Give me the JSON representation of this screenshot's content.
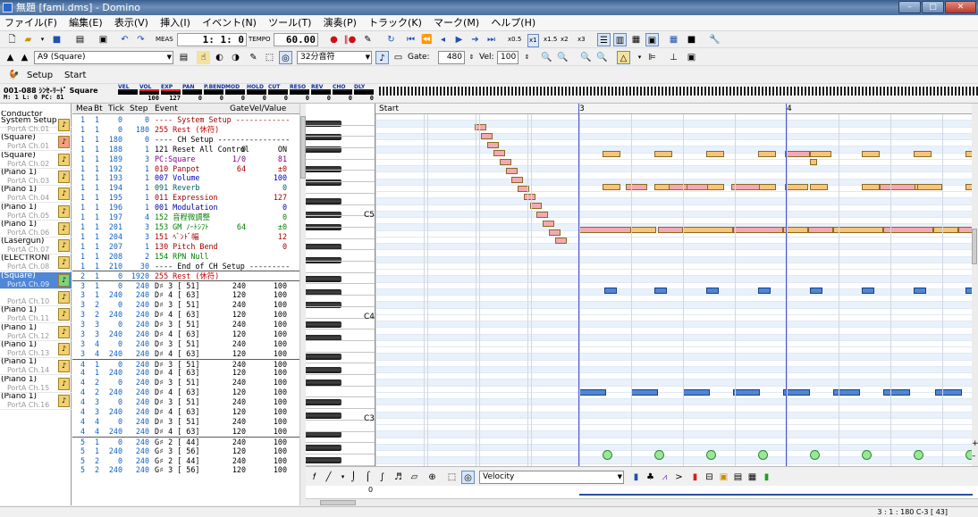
{
  "window": {
    "title": "無題 [fami.dms] - Domino",
    "min": "–",
    "max": "□",
    "close": "✕"
  },
  "menu": [
    "ファイル(F)",
    "編集(E)",
    "表示(V)",
    "挿入(I)",
    "イベント(N)",
    "ツール(T)",
    "演奏(P)",
    "トラック(K)",
    "マーク(M)",
    "ヘルプ(H)"
  ],
  "toolbar1": {
    "meas_label": "MEAS",
    "position": "1:  1:    0",
    "tempo_label": "TEMPO",
    "tempo": "60.00",
    "speeds": [
      "x0.5",
      "x1",
      "x1.5",
      "x2",
      "x3"
    ]
  },
  "toolbar2": {
    "track_combo": "A9 (Square)",
    "note_length": "32分音符",
    "gate_label": "Gate:",
    "gate": "480",
    "vel_label": "Vel:",
    "vel": "100"
  },
  "toolbar3": {
    "setup": "Setup",
    "start": "Start"
  },
  "channel": {
    "range": "001-088 ｼﾝｾ-ﾘｰﾄﾞ Square",
    "m": "M:",
    "m_val": "1",
    "l": "L:",
    "l_val": "0",
    "pc": "PC:",
    "pc_val": "81",
    "labels": [
      "VEL",
      "VOL",
      "EXP",
      "PAN",
      "P.BEND",
      "MOD",
      "HOLD",
      "CUT",
      "RESO",
      "REV",
      "CHO",
      "DLY"
    ],
    "values": [
      "",
      "100",
      "127",
      "0",
      "0",
      "0",
      "0",
      "0",
      "0",
      "0",
      "0",
      "0"
    ]
  },
  "tracks": [
    {
      "name": "Conductor",
      "port": ""
    },
    {
      "name": "System Setup",
      "port": "PortA  Ch.01"
    },
    {
      "name": "(Square)",
      "port": "PortA  Ch.01"
    },
    {
      "name": "(Square)",
      "port": "PortA  Ch.02"
    },
    {
      "name": "(Piano 1)",
      "port": "PortA  Ch.03"
    },
    {
      "name": "(Piano 1)",
      "port": "PortA  Ch.04"
    },
    {
      "name": "(Piano 1)",
      "port": "PortA  Ch.05"
    },
    {
      "name": "(Piano 1)",
      "port": "PortA  Ch.06"
    },
    {
      "name": "(Lasergun)",
      "port": "PortA  Ch.07"
    },
    {
      "name": "(ELECTRONI",
      "port": "PortA  Ch.08"
    },
    {
      "name": "(Square)",
      "port": "PortA  Ch.09",
      "selected": true
    },
    {
      "name": "",
      "port": "PortA  Ch.10"
    },
    {
      "name": "(Piano 1)",
      "port": "PortA  Ch.11"
    },
    {
      "name": "(Piano 1)",
      "port": "PortA  Ch.12"
    },
    {
      "name": "(Piano 1)",
      "port": "PortA  Ch.13"
    },
    {
      "name": "(Piano 1)",
      "port": "PortA  Ch.14"
    },
    {
      "name": "(Piano 1)",
      "port": "PortA  Ch.15"
    },
    {
      "name": "(Piano 1)",
      "port": "PortA  Ch.16"
    }
  ],
  "event_headers": [
    "Mea",
    "Bt",
    "Tick",
    "Step",
    "Event",
    "Gate",
    "Vel/Value"
  ],
  "events": [
    [
      "1",
      "1",
      "0",
      "0",
      "---- System Setup ------------",
      "",
      "",
      "#a00000"
    ],
    [
      "1",
      "1",
      "0",
      "180",
      "255 Rest (休符)",
      "",
      "",
      "#c00000"
    ],
    [
      "1",
      "1",
      "180",
      "0",
      "---- CH Setup ----------------",
      "",
      "",
      "#000000"
    ],
    [
      "1",
      "1",
      "188",
      "1",
      "121 Reset All Control",
      "0",
      "ON",
      "#000000"
    ],
    [
      "1",
      "1",
      "189",
      "3",
      "PC:Square",
      "1/0",
      "81",
      "#7a008a"
    ],
    [
      "1",
      "1",
      "192",
      "1",
      "010 Panpot",
      "64",
      "±0",
      "#a00000"
    ],
    [
      "1",
      "1",
      "193",
      "1",
      "007 Volume",
      "",
      "100",
      "#0000c0"
    ],
    [
      "1",
      "1",
      "194",
      "1",
      "091 Reverb",
      "",
      "0",
      "#006060"
    ],
    [
      "1",
      "1",
      "195",
      "1",
      "011 Expression",
      "",
      "127",
      "#a00000"
    ],
    [
      "1",
      "1",
      "196",
      "1",
      "001 Modulation",
      "",
      "0",
      "#0000a0"
    ],
    [
      "1",
      "1",
      "197",
      "4",
      "152 音程微調整",
      "",
      "0",
      "#008000"
    ],
    [
      "1",
      "1",
      "201",
      "3",
      "153 GM ﾉｰﾄｼﾌﾄ",
      "64",
      "±0",
      "#008000"
    ],
    [
      "1",
      "1",
      "204",
      "3",
      "151 ﾍﾞﾝﾄﾞ幅",
      "",
      "12",
      "#a00000"
    ],
    [
      "1",
      "1",
      "207",
      "1",
      "130 Pitch Bend",
      "",
      "0",
      "#a00000"
    ],
    [
      "1",
      "1",
      "208",
      "2",
      "154 RPN Null",
      "",
      "",
      "#008000"
    ],
    [
      "1",
      "1",
      "210",
      "30",
      "---- End of CH Setup ---------",
      "",
      "",
      "#000000"
    ],
    [
      "2",
      "1",
      "0",
      "1920",
      "255 Rest (休符)",
      "",
      "",
      "#c00000"
    ],
    [
      "3",
      "1",
      "0",
      "240",
      "D♯ 3 [ 51]",
      "240",
      "100",
      "#000000"
    ],
    [
      "3",
      "1",
      "240",
      "240",
      "D♯ 4 [ 63]",
      "120",
      "100",
      "#000000"
    ],
    [
      "3",
      "2",
      "0",
      "240",
      "D♯ 3 [ 51]",
      "240",
      "100",
      "#000000"
    ],
    [
      "3",
      "2",
      "240",
      "240",
      "D♯ 4 [ 63]",
      "120",
      "100",
      "#000000"
    ],
    [
      "3",
      "3",
      "0",
      "240",
      "D♯ 3 [ 51]",
      "240",
      "100",
      "#000000"
    ],
    [
      "3",
      "3",
      "240",
      "240",
      "D♯ 4 [ 63]",
      "120",
      "100",
      "#000000"
    ],
    [
      "3",
      "4",
      "0",
      "240",
      "D♯ 3 [ 51]",
      "240",
      "100",
      "#000000"
    ],
    [
      "3",
      "4",
      "240",
      "240",
      "D♯ 4 [ 63]",
      "120",
      "100",
      "#000000"
    ],
    [
      "4",
      "1",
      "0",
      "240",
      "D♯ 3 [ 51]",
      "240",
      "100",
      "#000000"
    ],
    [
      "4",
      "1",
      "240",
      "240",
      "D♯ 4 [ 63]",
      "120",
      "100",
      "#000000"
    ],
    [
      "4",
      "2",
      "0",
      "240",
      "D♯ 3 [ 51]",
      "240",
      "100",
      "#000000"
    ],
    [
      "4",
      "2",
      "240",
      "240",
      "D♯ 4 [ 63]",
      "120",
      "100",
      "#000000"
    ],
    [
      "4",
      "3",
      "0",
      "240",
      "D♯ 3 [ 51]",
      "240",
      "100",
      "#000000"
    ],
    [
      "4",
      "3",
      "240",
      "240",
      "D♯ 4 [ 63]",
      "120",
      "100",
      "#000000"
    ],
    [
      "4",
      "4",
      "0",
      "240",
      "D♯ 3 [ 51]",
      "240",
      "100",
      "#000000"
    ],
    [
      "4",
      "4",
      "240",
      "240",
      "D♯ 4 [ 63]",
      "120",
      "100",
      "#000000"
    ],
    [
      "5",
      "1",
      "0",
      "240",
      "G♯ 2 [ 44]",
      "240",
      "100",
      "#000000"
    ],
    [
      "5",
      "1",
      "240",
      "240",
      "G♯ 3 [ 56]",
      "120",
      "100",
      "#000000"
    ],
    [
      "5",
      "2",
      "0",
      "240",
      "G♯ 2 [ 44]",
      "240",
      "100",
      "#000000"
    ],
    [
      "5",
      "2",
      "240",
      "240",
      "G♯ 3 [ 56]",
      "120",
      "100",
      "#000000"
    ]
  ],
  "pianoroll": {
    "start_label": "Start",
    "measures": [
      "3",
      "4"
    ],
    "octaves": [
      "C5",
      "C4",
      "C3"
    ]
  },
  "bottom": {
    "controller": "Velocity",
    "zero": "0"
  },
  "status": "3 : 1 : 180    C-3 [ 43]",
  "colors": {
    "pink": "#f4a8b4",
    "orange": "#f7c47a",
    "blue": "#4f86d6",
    "green": "#9be69b",
    "title": "#4b6f9c",
    "selected": "#4f86d6"
  }
}
